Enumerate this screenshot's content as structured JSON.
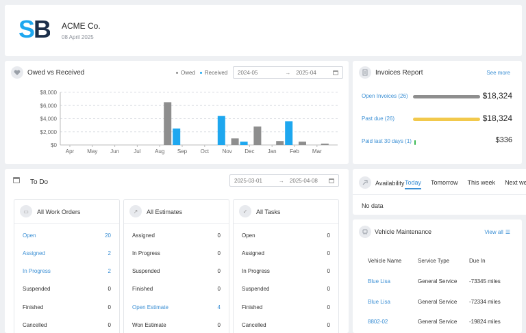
{
  "company": {
    "logo_text": "SB",
    "name": "ACME Co.",
    "date": "08 April 2025"
  },
  "owed_received": {
    "title": "Owed vs Received",
    "legend_owed": "Owed",
    "legend_received": "Received",
    "date_from": "2024-05",
    "date_to": "2025-04",
    "arrow": "→"
  },
  "chart_data": {
    "type": "bar",
    "categories": [
      "Apr",
      "May",
      "Jun",
      "Jul",
      "Aug",
      "Sep",
      "Oct",
      "Nov",
      "Dec",
      "Jan",
      "Feb",
      "Mar"
    ],
    "series": [
      {
        "name": "Owed",
        "values": [
          0,
          0,
          0,
          0,
          6500,
          0,
          0,
          1000,
          2800,
          600,
          500,
          200
        ]
      },
      {
        "name": "Received",
        "values": [
          0,
          0,
          0,
          0,
          2500,
          0,
          4400,
          500,
          0,
          3600,
          0,
          0
        ]
      }
    ],
    "yticks": [
      "$0",
      "$2,000",
      "$4,000",
      "$6,000",
      "$8,000"
    ],
    "ylim": [
      0,
      8000
    ],
    "colors": {
      "owed": "#8e8e8e",
      "received": "#1ea7ef"
    },
    "grid": true
  },
  "invoices": {
    "title": "Invoices Report",
    "see_more": "See more",
    "rows": [
      {
        "label": "Open Invoices (26)",
        "amount": "$18,324",
        "fill": 1.0,
        "color": "#8e8e8e"
      },
      {
        "label": "Past due (26)",
        "amount": "$18,324",
        "fill": 1.0,
        "color": "#f2c94c"
      },
      {
        "label": "Paid last 30 days (1)",
        "amount": "$336",
        "fill": 0.02,
        "color": "#3cba54"
      }
    ]
  },
  "todo": {
    "title": "To Do",
    "date_from": "2025-03-01",
    "date_to": "2025-04-08",
    "arrow": "→",
    "panels": [
      {
        "title": "All Work Orders",
        "icon": "briefcase-icon",
        "rows": [
          {
            "label": "Open",
            "value": "20",
            "link": true
          },
          {
            "label": "Assigned",
            "value": "2",
            "link": true
          },
          {
            "label": "In Progress",
            "value": "2",
            "link": true
          },
          {
            "label": "Suspended",
            "value": "0",
            "link": false
          },
          {
            "label": "Finished",
            "value": "0",
            "link": false
          },
          {
            "label": "Cancelled",
            "value": "0",
            "link": false
          }
        ]
      },
      {
        "title": "All Estimates",
        "icon": "trend-icon",
        "rows": [
          {
            "label": "Assigned",
            "value": "0",
            "link": false
          },
          {
            "label": "In Progress",
            "value": "0",
            "link": false
          },
          {
            "label": "Suspended",
            "value": "0",
            "link": false
          },
          {
            "label": "Finished",
            "value": "0",
            "link": false
          },
          {
            "label": "Open Estimate",
            "value": "4",
            "link": true
          },
          {
            "label": "Won Estimate",
            "value": "0",
            "link": false
          }
        ]
      },
      {
        "title": "All Tasks",
        "icon": "check-circle-icon",
        "rows": [
          {
            "label": "Open",
            "value": "0",
            "link": false
          },
          {
            "label": "Assigned",
            "value": "0",
            "link": false
          },
          {
            "label": "In Progress",
            "value": "0",
            "link": false
          },
          {
            "label": "Suspended",
            "value": "0",
            "link": false
          },
          {
            "label": "Finished",
            "value": "0",
            "link": false
          },
          {
            "label": "Cancelled",
            "value": "0",
            "link": false
          }
        ]
      }
    ]
  },
  "availability": {
    "title": "Availability",
    "tabs": [
      "Today",
      "Tomorrow",
      "This week",
      "Next week"
    ],
    "active_tab": 0,
    "empty": "No data"
  },
  "vehicle": {
    "title": "Vehicle Maintenance",
    "view_all": "View all",
    "headers": [
      "Vehicle Name",
      "Service Type",
      "Due In"
    ],
    "rows": [
      [
        "Blue Lisa",
        "General Service",
        "-73345 miles"
      ],
      [
        "Blue Lisa",
        "General Service",
        "-72334 miles"
      ],
      [
        "8802-02",
        "General Service",
        "-19824 miles"
      ]
    ]
  }
}
